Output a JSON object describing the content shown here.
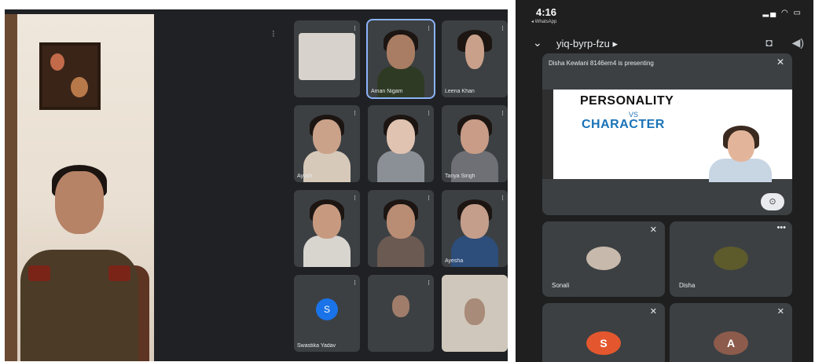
{
  "desktop": {
    "pin_icon": "pin-icon",
    "tiles": [
      {
        "name": "",
        "skin": "#d8d2cc",
        "torso": "#b9b3ad"
      },
      {
        "name": "Aman Nigam",
        "skin": "#a97d63",
        "torso": "#2f3a25"
      },
      {
        "name": "Leena Khan",
        "skin": "#c9a08a",
        "torso": "#1f1f1f"
      },
      {
        "name": "Ayush",
        "skin": "#caa28a",
        "torso": "#d6c9b9"
      },
      {
        "name": "",
        "skin": "#e0c3b1",
        "torso": "#8b8f96"
      },
      {
        "name": "Tanya Singh",
        "skin": "#c89c86",
        "torso": "#6f6f76"
      },
      {
        "name": "",
        "skin": "#c79a80",
        "torso": "#d8d5cf"
      },
      {
        "name": "",
        "skin": "#b98c74",
        "torso": "#6b5a52"
      },
      {
        "name": "Ayesha",
        "skin": "#c49e8a",
        "torso": "#2d4d7a"
      },
      {
        "name": "Swastika Yadav",
        "avatar": "S",
        "skin": "",
        "torso": ""
      },
      {
        "name": "",
        "skin": "#a07c6a",
        "torso": "#383838"
      },
      {
        "name": "",
        "skin": "#d7cfc4",
        "torso": "#cfc7bb"
      }
    ]
  },
  "phone": {
    "status_time": "4:16",
    "status_sub": "◂ WhatsApp",
    "meeting_code": "yiq-byrp-fzu ▸",
    "presenting_text": "Disha Kewlani 8146em4 is presenting",
    "slide": {
      "title_1": "PERSONALITY",
      "title_vs": "VS",
      "title_2": "CHARACTER"
    },
    "participants": [
      {
        "name": "Sonali",
        "photo": "#c7b9ab"
      },
      {
        "name": "Disha",
        "photo": "#5d5a2c"
      },
      {
        "name": "",
        "letter": "S",
        "color": "#e4572e"
      },
      {
        "name": "",
        "letter": "A",
        "color": "#8d5b4c"
      }
    ]
  }
}
